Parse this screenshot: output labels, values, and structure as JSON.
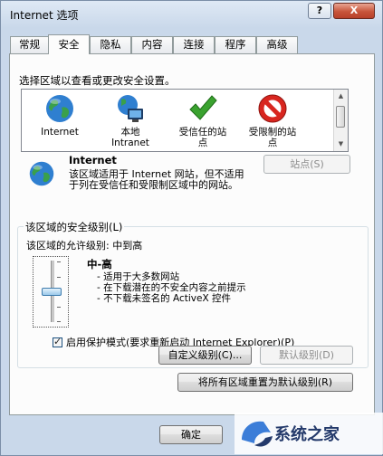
{
  "window": {
    "title": "Internet 选项",
    "help_label": "?",
    "close_label": "X"
  },
  "tabs": [
    {
      "label": "常规",
      "active": false
    },
    {
      "label": "安全",
      "active": true
    },
    {
      "label": "隐私",
      "active": false
    },
    {
      "label": "内容",
      "active": false
    },
    {
      "label": "连接",
      "active": false
    },
    {
      "label": "程序",
      "active": false
    },
    {
      "label": "高级",
      "active": false
    }
  ],
  "security": {
    "instruction": "选择区域以查看或更改安全设置。",
    "zones": [
      {
        "label": "Internet",
        "icon": "globe-icon",
        "selected": true
      },
      {
        "label": "本地\nIntranet",
        "icon": "intranet-icon",
        "selected": false
      },
      {
        "label": "受信任的站\n点",
        "icon": "trusted-check-icon",
        "selected": false
      },
      {
        "label": "受限制的站\n点",
        "icon": "restricted-icon",
        "selected": false
      }
    ],
    "selected_zone": {
      "name": "Internet",
      "description": "该区域适用于 Internet 网站，但不适用于列在受信任和受限制区域中的网站。"
    },
    "sites_button": "站点(S)",
    "level_group": {
      "legend": "该区域的安全级别(L)",
      "allowed_levels": "该区域的允许级别: 中到高",
      "level_name": "中-高",
      "level_details": [
        "- 适用于大多数网站",
        "- 在下载潜在的不安全内容之前提示",
        "- 不下载未签名的 ActiveX 控件"
      ],
      "slider_level": 0.5,
      "protected_mode_label": "启用保护模式(要求重新启动 Internet Explorer)(P)",
      "protected_mode_checked": true,
      "custom_level_button": "自定义级别(C)...",
      "default_level_button": "默认级别(D)"
    },
    "reset_all_button": "将所有区域重置为默认级别(R)"
  },
  "footer": {
    "ok_button": "确定"
  },
  "watermark": {
    "text": "系统之家"
  },
  "colors": {
    "globe_blue": "#2f7fd0",
    "globe_green": "#3aa04a",
    "check_green": "#3aa22f",
    "restricted_red": "#d8261f"
  }
}
